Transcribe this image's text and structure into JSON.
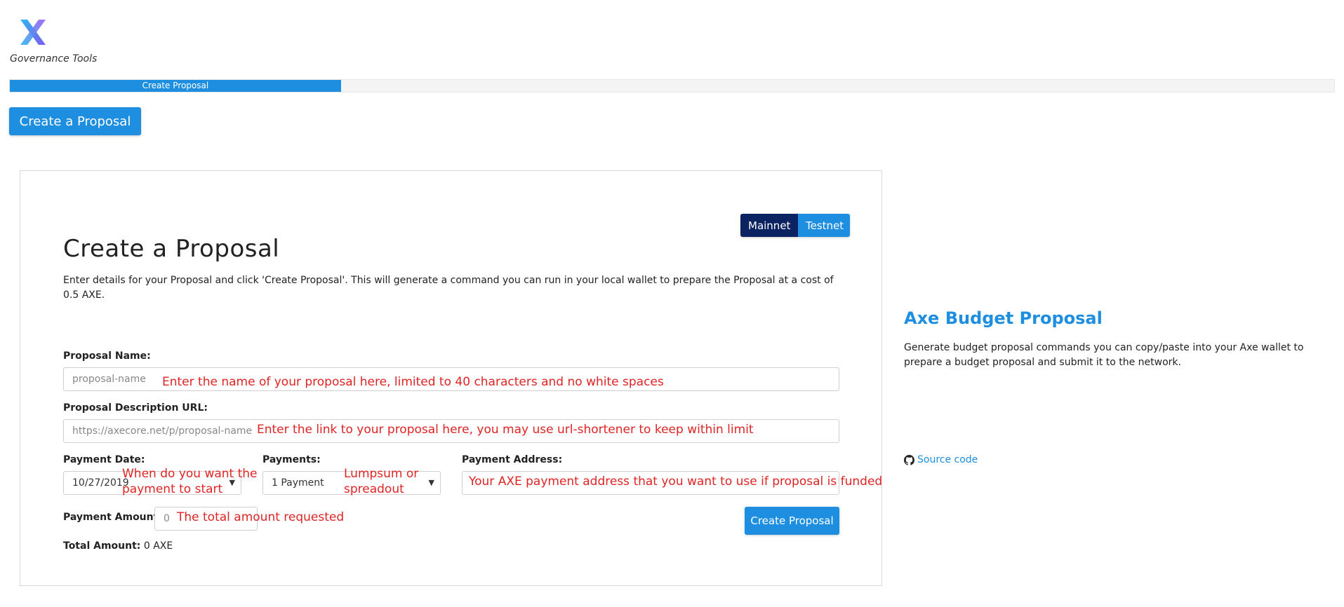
{
  "brand": {
    "subtitle": "Governance Tools",
    "logo_icon": "axe-x-logo-icon"
  },
  "progress": {
    "label": "Create Proposal",
    "fraction": 0.25
  },
  "top_button": "Create a Proposal",
  "network": {
    "mainnet": "Mainnet",
    "testnet": "Testnet",
    "selected": "Mainnet"
  },
  "form": {
    "title": "Create a Proposal",
    "description": "Enter details for your Proposal and click 'Create Proposal'. This will generate a command you can run in your local wallet to prepare the Proposal at a cost of 0.5 AXE.",
    "proposal_name_label": "Proposal Name:",
    "proposal_name_placeholder": "proposal-name",
    "proposal_name_note": "Enter the name of your proposal here, limited to 40 characters and no white spaces",
    "url_label": "Proposal Description URL:",
    "url_placeholder": "https://axecore.net/p/proposal-name",
    "url_note": "Enter the link to your proposal here, you may use url-shortener to keep within limit",
    "payment_date_label": "Payment Date:",
    "payment_date_value": "10/27/2019",
    "payment_date_note": "When do you want the payment to start",
    "payments_label": "Payments:",
    "payments_value": "1 Payment",
    "payments_note": "Lumpsum or spreadout",
    "address_label": "Payment Address:",
    "address_note": "Your AXE payment address that you want to use if proposal is funded",
    "amount_label": "Payment Amount:",
    "amount_value": "0",
    "amount_note": "The total amount requested",
    "submit_label": "Create Proposal",
    "total_label": "Total Amount:",
    "total_value": "0 AXE"
  },
  "side": {
    "title": "Axe Budget Proposal",
    "description": "Generate budget proposal commands you can copy/paste into your Axe wallet to prepare a budget proposal and submit it to the network.",
    "source_link": "Source code",
    "source_icon": "github-icon"
  },
  "colors": {
    "accent": "#1e8fe0",
    "mainnet_bg": "#0b2360",
    "note": "#e02424"
  }
}
